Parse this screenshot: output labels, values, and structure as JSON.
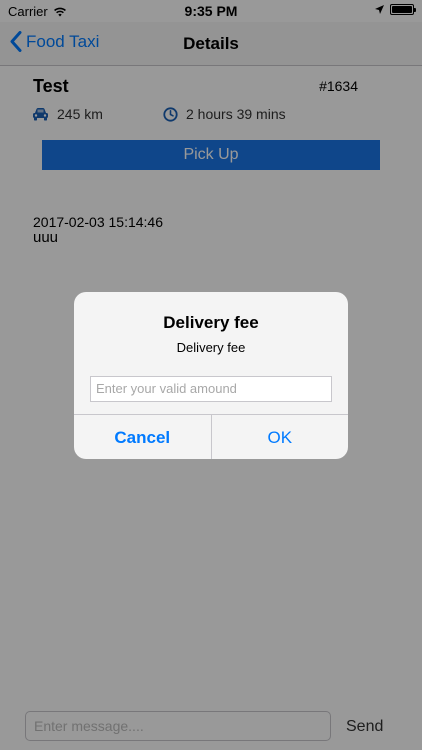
{
  "status_bar": {
    "carrier": "Carrier",
    "time": "9:35 PM"
  },
  "nav": {
    "back_label": "Food Taxi",
    "title": "Details"
  },
  "order": {
    "title": "Test",
    "id": "#1634",
    "distance": "245 km",
    "duration": "2 hours 39 mins",
    "pickup_label": "Pick Up"
  },
  "message": {
    "timestamp": "2017-02-03 15:14:46",
    "text": "uuu"
  },
  "composer": {
    "placeholder": "Enter message....",
    "send_label": "Send"
  },
  "alert": {
    "title": "Delivery fee",
    "message": "Delivery fee",
    "input_placeholder": "Enter your valid amound",
    "cancel_label": "Cancel",
    "ok_label": "OK"
  },
  "colors": {
    "accent": "#007aff",
    "pickup_button": "#1975e6",
    "icon_blue": "#1a5fb4"
  }
}
